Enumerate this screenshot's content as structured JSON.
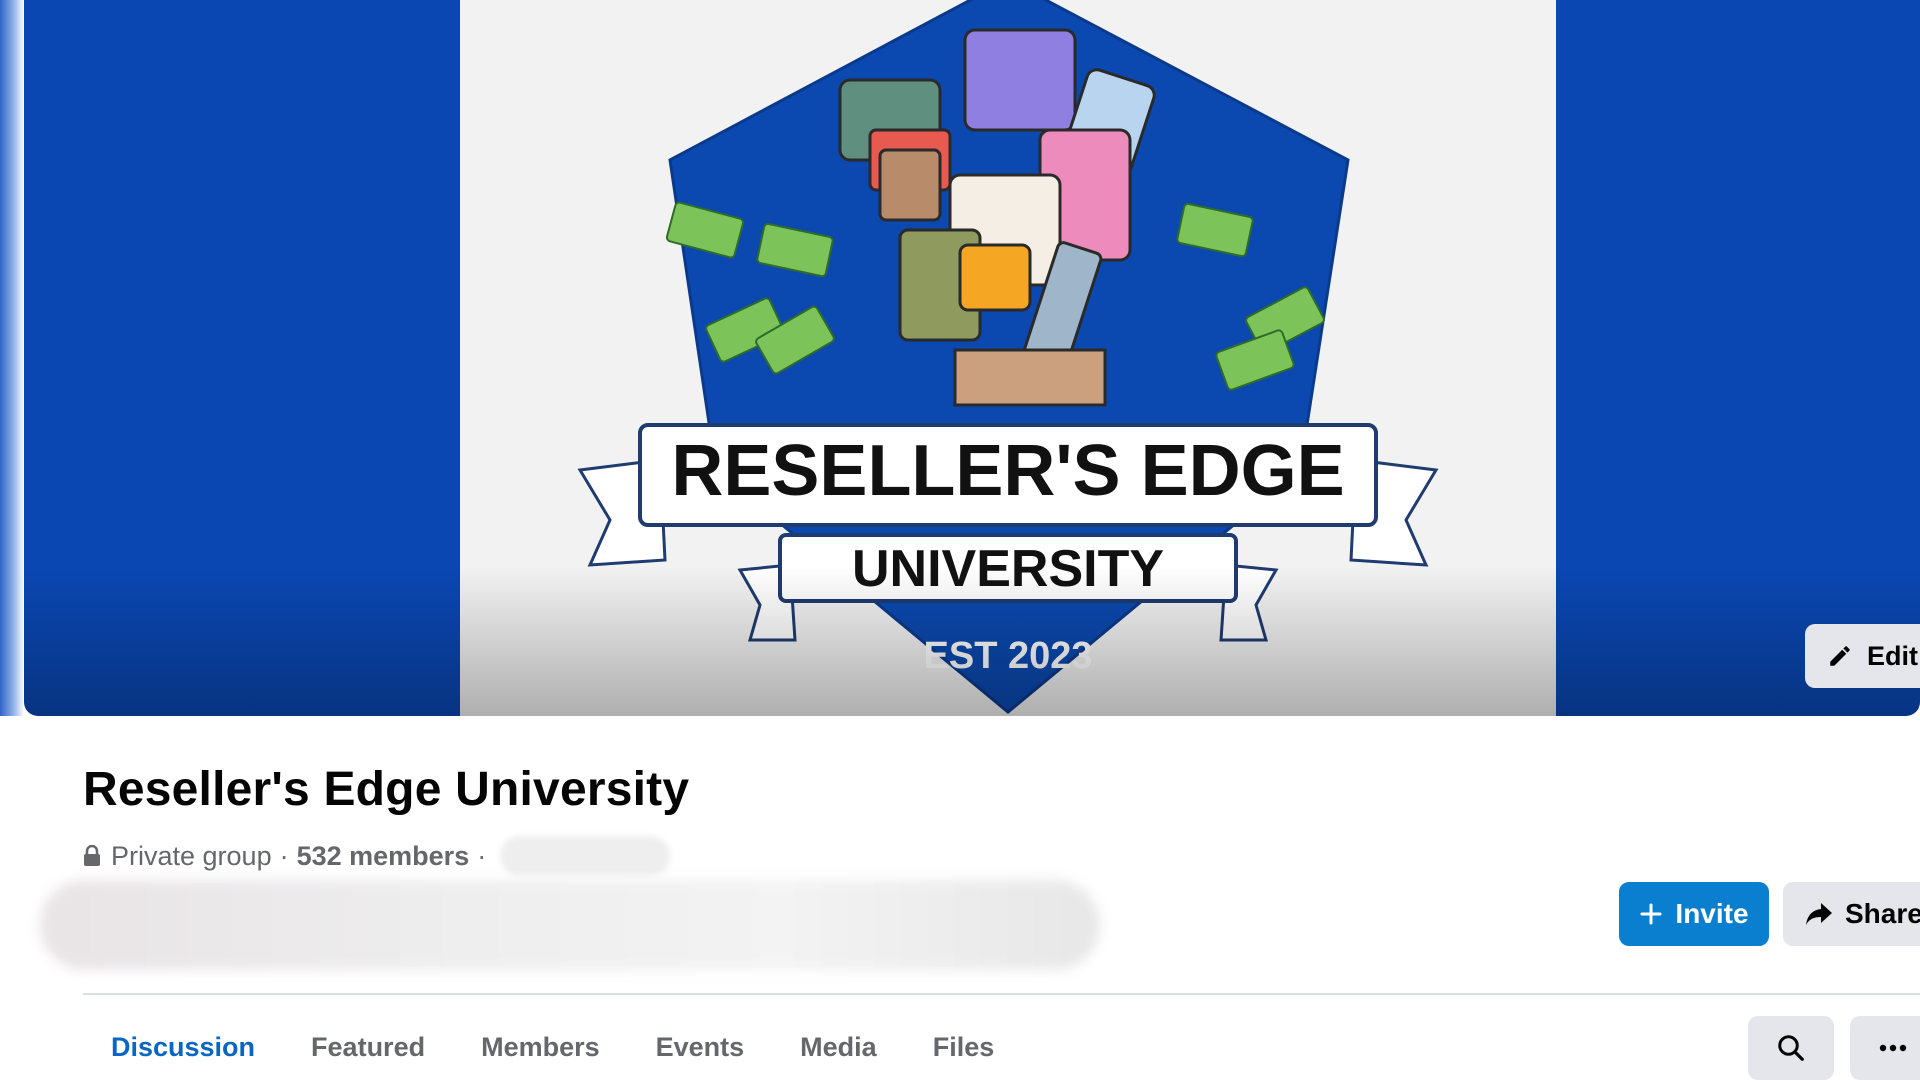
{
  "cover": {
    "logo_title": "RESELLER'S EDGE",
    "logo_subtitle": "UNIVERSITY",
    "logo_est": "EST 2023",
    "edit_label": "Edit"
  },
  "group": {
    "name": "Reseller's Edge University",
    "privacy": "Private group",
    "separator": "·",
    "members": "532 members"
  },
  "actions": {
    "invite_label": "Invite",
    "share_label": "Share"
  },
  "tabs": [
    {
      "label": "Discussion",
      "active": true
    },
    {
      "label": "Featured"
    },
    {
      "label": "Members"
    },
    {
      "label": "Events"
    },
    {
      "label": "Media"
    },
    {
      "label": "Files"
    }
  ],
  "icons": {
    "lock": "lock-icon",
    "pencil": "pencil-icon",
    "plus": "plus-icon",
    "share": "share-arrow-icon",
    "search": "search-icon",
    "more": "more-horizontal-icon"
  },
  "colors": {
    "cover_blue": "#0a47b3",
    "accent": "#0a7fcf",
    "active_tab": "#0a66c2"
  }
}
